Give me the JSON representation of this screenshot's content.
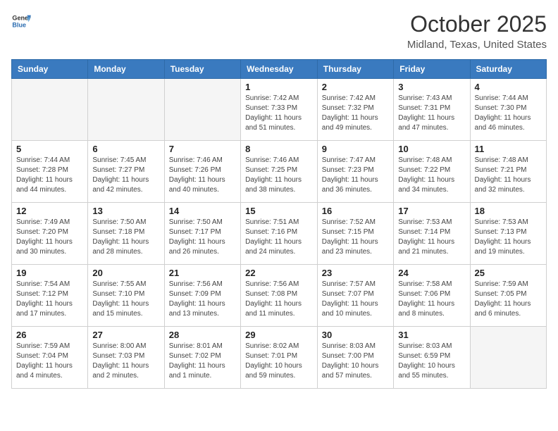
{
  "header": {
    "logo_general": "General",
    "logo_blue": "Blue",
    "month": "October 2025",
    "location": "Midland, Texas, United States"
  },
  "days_of_week": [
    "Sunday",
    "Monday",
    "Tuesday",
    "Wednesday",
    "Thursday",
    "Friday",
    "Saturday"
  ],
  "weeks": [
    [
      {
        "day": "",
        "info": ""
      },
      {
        "day": "",
        "info": ""
      },
      {
        "day": "",
        "info": ""
      },
      {
        "day": "1",
        "info": "Sunrise: 7:42 AM\nSunset: 7:33 PM\nDaylight: 11 hours\nand 51 minutes."
      },
      {
        "day": "2",
        "info": "Sunrise: 7:42 AM\nSunset: 7:32 PM\nDaylight: 11 hours\nand 49 minutes."
      },
      {
        "day": "3",
        "info": "Sunrise: 7:43 AM\nSunset: 7:31 PM\nDaylight: 11 hours\nand 47 minutes."
      },
      {
        "day": "4",
        "info": "Sunrise: 7:44 AM\nSunset: 7:30 PM\nDaylight: 11 hours\nand 46 minutes."
      }
    ],
    [
      {
        "day": "5",
        "info": "Sunrise: 7:44 AM\nSunset: 7:28 PM\nDaylight: 11 hours\nand 44 minutes."
      },
      {
        "day": "6",
        "info": "Sunrise: 7:45 AM\nSunset: 7:27 PM\nDaylight: 11 hours\nand 42 minutes."
      },
      {
        "day": "7",
        "info": "Sunrise: 7:46 AM\nSunset: 7:26 PM\nDaylight: 11 hours\nand 40 minutes."
      },
      {
        "day": "8",
        "info": "Sunrise: 7:46 AM\nSunset: 7:25 PM\nDaylight: 11 hours\nand 38 minutes."
      },
      {
        "day": "9",
        "info": "Sunrise: 7:47 AM\nSunset: 7:23 PM\nDaylight: 11 hours\nand 36 minutes."
      },
      {
        "day": "10",
        "info": "Sunrise: 7:48 AM\nSunset: 7:22 PM\nDaylight: 11 hours\nand 34 minutes."
      },
      {
        "day": "11",
        "info": "Sunrise: 7:48 AM\nSunset: 7:21 PM\nDaylight: 11 hours\nand 32 minutes."
      }
    ],
    [
      {
        "day": "12",
        "info": "Sunrise: 7:49 AM\nSunset: 7:20 PM\nDaylight: 11 hours\nand 30 minutes."
      },
      {
        "day": "13",
        "info": "Sunrise: 7:50 AM\nSunset: 7:18 PM\nDaylight: 11 hours\nand 28 minutes."
      },
      {
        "day": "14",
        "info": "Sunrise: 7:50 AM\nSunset: 7:17 PM\nDaylight: 11 hours\nand 26 minutes."
      },
      {
        "day": "15",
        "info": "Sunrise: 7:51 AM\nSunset: 7:16 PM\nDaylight: 11 hours\nand 24 minutes."
      },
      {
        "day": "16",
        "info": "Sunrise: 7:52 AM\nSunset: 7:15 PM\nDaylight: 11 hours\nand 23 minutes."
      },
      {
        "day": "17",
        "info": "Sunrise: 7:53 AM\nSunset: 7:14 PM\nDaylight: 11 hours\nand 21 minutes."
      },
      {
        "day": "18",
        "info": "Sunrise: 7:53 AM\nSunset: 7:13 PM\nDaylight: 11 hours\nand 19 minutes."
      }
    ],
    [
      {
        "day": "19",
        "info": "Sunrise: 7:54 AM\nSunset: 7:12 PM\nDaylight: 11 hours\nand 17 minutes."
      },
      {
        "day": "20",
        "info": "Sunrise: 7:55 AM\nSunset: 7:10 PM\nDaylight: 11 hours\nand 15 minutes."
      },
      {
        "day": "21",
        "info": "Sunrise: 7:56 AM\nSunset: 7:09 PM\nDaylight: 11 hours\nand 13 minutes."
      },
      {
        "day": "22",
        "info": "Sunrise: 7:56 AM\nSunset: 7:08 PM\nDaylight: 11 hours\nand 11 minutes."
      },
      {
        "day": "23",
        "info": "Sunrise: 7:57 AM\nSunset: 7:07 PM\nDaylight: 11 hours\nand 10 minutes."
      },
      {
        "day": "24",
        "info": "Sunrise: 7:58 AM\nSunset: 7:06 PM\nDaylight: 11 hours\nand 8 minutes."
      },
      {
        "day": "25",
        "info": "Sunrise: 7:59 AM\nSunset: 7:05 PM\nDaylight: 11 hours\nand 6 minutes."
      }
    ],
    [
      {
        "day": "26",
        "info": "Sunrise: 7:59 AM\nSunset: 7:04 PM\nDaylight: 11 hours\nand 4 minutes."
      },
      {
        "day": "27",
        "info": "Sunrise: 8:00 AM\nSunset: 7:03 PM\nDaylight: 11 hours\nand 2 minutes."
      },
      {
        "day": "28",
        "info": "Sunrise: 8:01 AM\nSunset: 7:02 PM\nDaylight: 11 hours\nand 1 minute."
      },
      {
        "day": "29",
        "info": "Sunrise: 8:02 AM\nSunset: 7:01 PM\nDaylight: 10 hours\nand 59 minutes."
      },
      {
        "day": "30",
        "info": "Sunrise: 8:03 AM\nSunset: 7:00 PM\nDaylight: 10 hours\nand 57 minutes."
      },
      {
        "day": "31",
        "info": "Sunrise: 8:03 AM\nSunset: 6:59 PM\nDaylight: 10 hours\nand 55 minutes."
      },
      {
        "day": "",
        "info": ""
      }
    ]
  ]
}
